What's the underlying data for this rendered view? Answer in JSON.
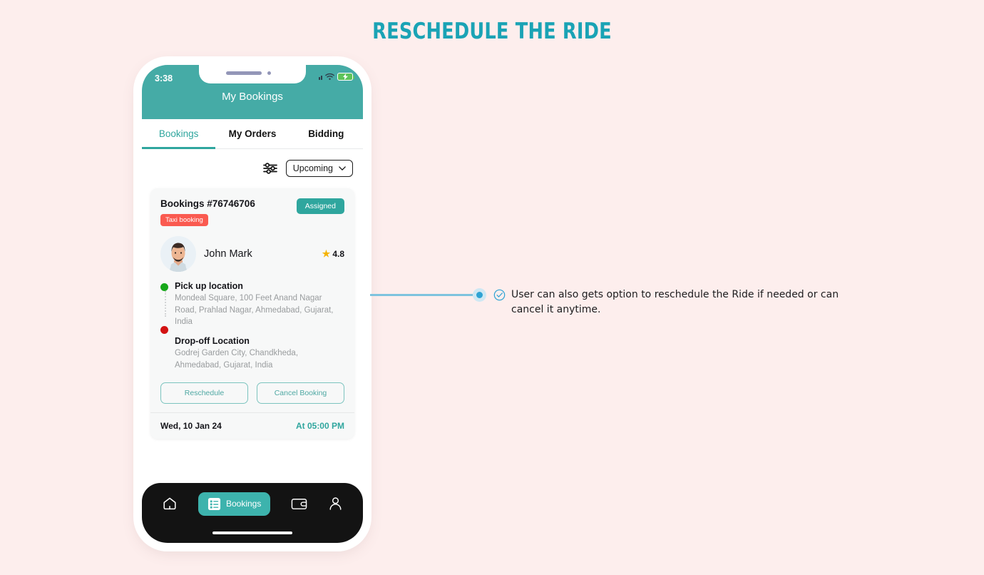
{
  "page": {
    "title": "RESCHEDULE THE RIDE",
    "background_color": "#fdeeed",
    "accent_color": "#1aa3b5"
  },
  "phone": {
    "status_bar": {
      "time": "3:38",
      "icons": [
        "signal-icon",
        "wifi-icon",
        "battery-charging-icon"
      ]
    },
    "app_bar": {
      "title": "My Bookings",
      "background_color": "#45aba6"
    },
    "tabs": [
      {
        "label": "Bookings",
        "active": true
      },
      {
        "label": "My Orders",
        "active": false
      },
      {
        "label": "Bidding",
        "active": false
      }
    ],
    "filter": {
      "icon": "filter-sliders-icon",
      "select_value": "Upcoming"
    },
    "booking_card": {
      "booking_id": "Bookings #76746706",
      "status_badge": "Assigned",
      "status_badge_color": "#2fa69e",
      "type_badge": "Taxi booking",
      "type_badge_color": "#fa5a50",
      "driver": {
        "name": "John Mark",
        "rating": "4.8"
      },
      "pickup": {
        "title": "Pick up location",
        "address": "Mondeal Square, 100 Feet Anand Nagar Road, Prahlad Nagar, Ahmedabad, Gujarat, India",
        "dot_color": "#17a81a"
      },
      "dropoff": {
        "title": "Drop-off Location",
        "address": "Godrej Garden City, Chandkheda, Ahmedabad, Gujarat, India",
        "dot_color": "#d31212"
      },
      "buttons": {
        "reschedule": "Reschedule",
        "cancel": "Cancel Booking"
      },
      "footer": {
        "date": "Wed, 10 Jan 24",
        "time": "At 05:00 PM"
      }
    },
    "bottom_nav": [
      {
        "label": "",
        "icon": "home-icon",
        "active": false
      },
      {
        "label": "Bookings",
        "icon": "bookings-list-icon",
        "active": true
      },
      {
        "label": "",
        "icon": "wallet-icon",
        "active": false
      },
      {
        "label": "",
        "icon": "person-icon",
        "active": false
      }
    ]
  },
  "annotation": {
    "text": "User can also gets option to reschedule the Ride if needed or can cancel it anytime.",
    "bullet_color": "#2fa3d4",
    "connector_color": "#7ec3de",
    "check_icon": "check-circle-icon"
  }
}
